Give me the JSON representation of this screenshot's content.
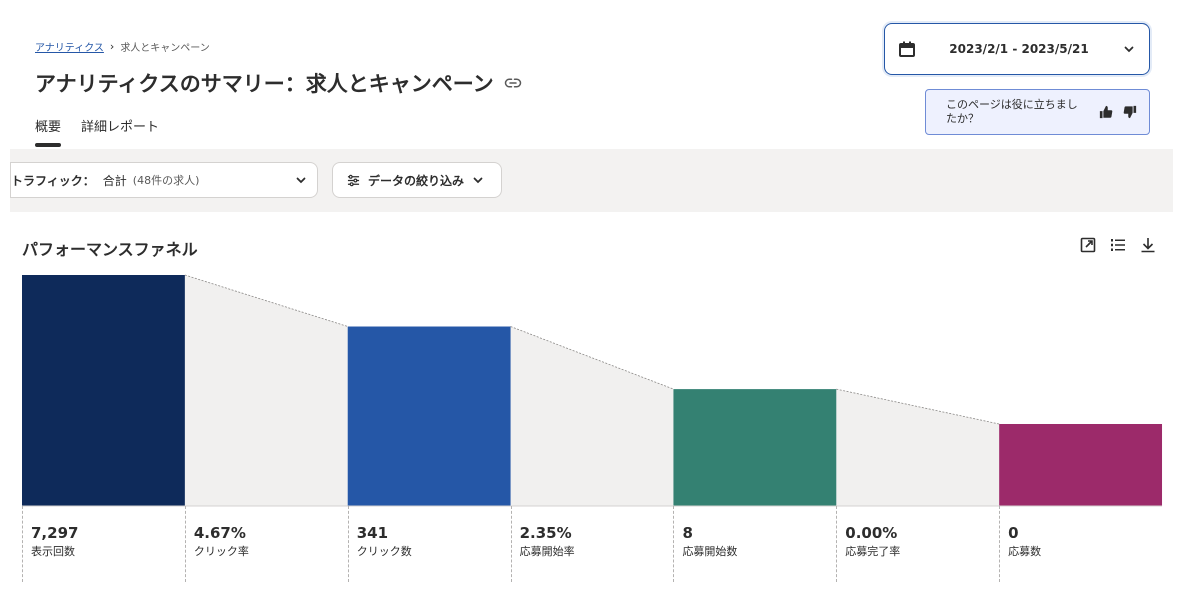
{
  "breadcrumb": {
    "parent": "アナリティクス",
    "separator": "›",
    "current": "求人とキャンペーン"
  },
  "page": {
    "title": "アナリティクスのサマリー：求人とキャンペーン"
  },
  "tabs": [
    {
      "label": "概要",
      "active": true
    },
    {
      "label": "詳細レポート",
      "active": false
    }
  ],
  "date_range": {
    "value": "2023/2/1 - 2023/5/21"
  },
  "feedback": {
    "question": "このページは役に立ちましたか？"
  },
  "filters": {
    "traffic_label": "トラフィック：",
    "traffic_value": "合計",
    "traffic_sub": "(48件の求人)",
    "data_filter_label": "データの絞り込み"
  },
  "section": {
    "title": "パフォーマンスファネル"
  },
  "colors": {
    "accent": "#2557a7",
    "impressions": "#0e2a5a",
    "clicks": "#2557a7",
    "apply_starts": "#348172",
    "applies": "#9c2a6a",
    "connector": "#f1f0ef"
  },
  "icons": {
    "calendar": "calendar-icon",
    "chevron": "chevron-down-icon",
    "link": "link-icon",
    "thumbs_up": "thumbs-up-icon",
    "thumbs_down": "thumbs-down-icon",
    "filter": "sliders-icon",
    "open": "open-external-icon",
    "list": "list-icon",
    "download": "download-icon"
  },
  "chart_data": {
    "type": "bar",
    "title": "パフォーマンスファネル",
    "categories": [
      "表示回数",
      "クリック数",
      "応募開始数",
      "応募数"
    ],
    "values": [
      7297,
      341,
      8,
      0
    ],
    "rates": [
      {
        "label": "クリック率",
        "value": "4.67%"
      },
      {
        "label": "応募開始率",
        "value": "2.35%"
      },
      {
        "label": "応募完了率",
        "value": "0.00%"
      }
    ],
    "displayed_values": [
      "7,297",
      "341",
      "8",
      "0"
    ],
    "relative_bar_heights": [
      1.0,
      0.777,
      0.506,
      0.355
    ],
    "grid": false
  },
  "stats": [
    {
      "value": "7,297",
      "label": "表示回数"
    },
    {
      "value": "4.67%",
      "label": "クリック率"
    },
    {
      "value": "341",
      "label": "クリック数"
    },
    {
      "value": "2.35%",
      "label": "応募開始率"
    },
    {
      "value": "8",
      "label": "応募開始数"
    },
    {
      "value": "0.00%",
      "label": "応募完了率"
    },
    {
      "value": "0",
      "label": "応募数"
    }
  ]
}
